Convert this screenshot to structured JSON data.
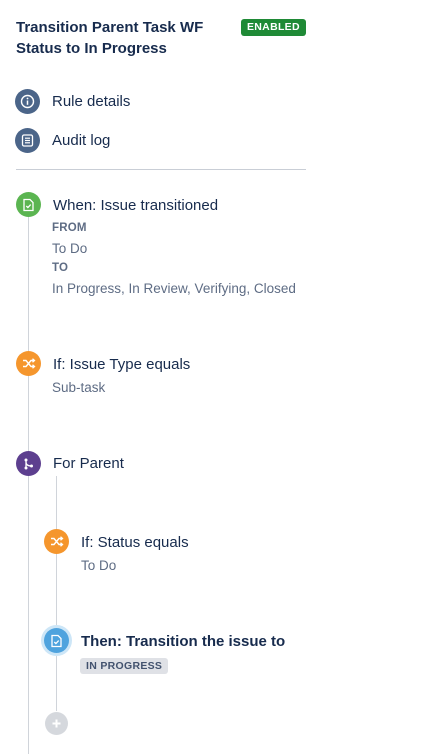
{
  "header": {
    "title": "Transition Parent Task WF Status to In Progress",
    "status_badge": "ENABLED"
  },
  "nav": {
    "items": [
      {
        "label": "Rule details",
        "icon": "info-icon"
      },
      {
        "label": "Audit log",
        "icon": "list-icon"
      }
    ]
  },
  "flow": {
    "trigger": {
      "title": "When: Issue transitioned",
      "from_label": "FROM",
      "from_value": "To Do",
      "to_label": "TO",
      "to_value": "In Progress, In Review, Verifying, Closed"
    },
    "condition1": {
      "title": "If: Issue Type equals",
      "value": "Sub-task"
    },
    "branch": {
      "title": "For Parent"
    },
    "condition2": {
      "title": "If: Status equals",
      "value": "To Do"
    },
    "action": {
      "title": "Then: Transition the issue to",
      "value": "IN PROGRESS"
    }
  },
  "colors": {
    "enabled": "#1f8a36",
    "trigger": "#5bb551",
    "condition": "#f5962d",
    "branch": "#5d3f8f",
    "action": "#4fa3de",
    "nav_icon": "#4b6589"
  }
}
